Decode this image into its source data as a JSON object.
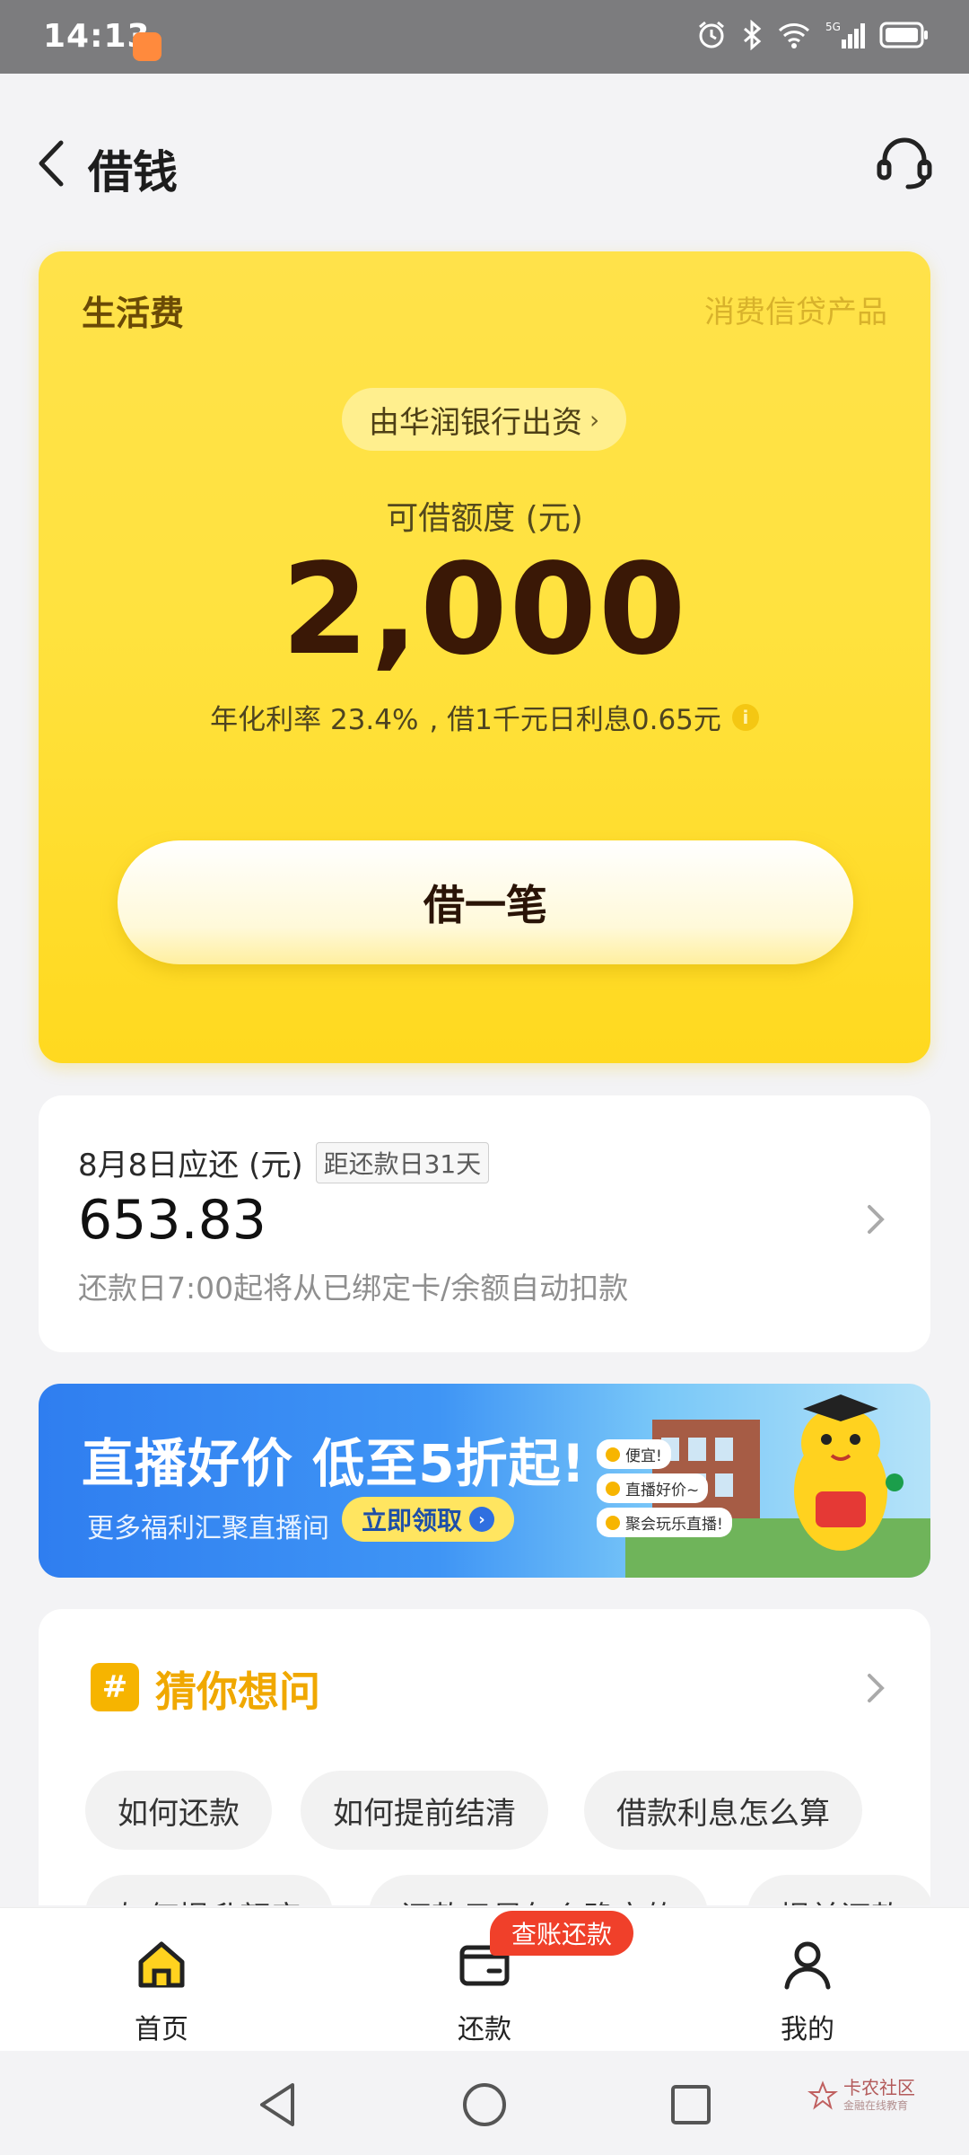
{
  "status_bar": {
    "time": "14:13",
    "network": "5G"
  },
  "header": {
    "title": "借钱"
  },
  "credit_card": {
    "product_name": "生活费",
    "product_type": "消费信贷产品",
    "bank_pill": "由华润银行出资",
    "bank_chevron": "›",
    "limit_label": "可借额度 (元)",
    "limit_value": "2,000",
    "rate_prefix": "年化利率 23.4%",
    "rate_suffix": ", 借1千元日利息0.65元",
    "borrow_button": "借一笔"
  },
  "repayment": {
    "label": "8月8日应还 (元)",
    "due_tag": "距还款日31天",
    "amount": "653.83",
    "note": "还款日7:00起将从已绑定卡/余额自动扣款"
  },
  "banner": {
    "title": "直播好价 低至5折起!",
    "subtitle": "更多福利汇聚直播间",
    "cta": "立即领取",
    "bubbles": [
      "便宜!",
      "直播好价~",
      "聚会玩乐直播!"
    ]
  },
  "faq": {
    "icon_glyph": "#",
    "title": "猜你想问",
    "chips": [
      "如何还款",
      "如何提前结清",
      "借款利息怎么算",
      "如何提升额度",
      "还款日是怎么确定的",
      "提前还款"
    ]
  },
  "bottom_nav": {
    "items": [
      {
        "label": "首页"
      },
      {
        "label": "还款"
      },
      {
        "label": "我的"
      }
    ],
    "badge": "查账还款"
  },
  "watermark": {
    "text": "卡农社区",
    "sub": "金融在线教育"
  },
  "colors": {
    "card_yellow": "#ffe23f",
    "accent_orange": "#f0a800",
    "badge_red": "#f0402a",
    "banner_blue": "#2f7ef0"
  }
}
